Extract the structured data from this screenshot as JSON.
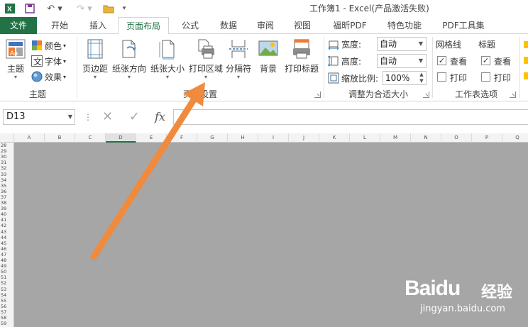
{
  "window": {
    "title": "工作簿1 - Excel(产品激活失败)"
  },
  "tabs": [
    {
      "label": "文件"
    },
    {
      "label": "开始"
    },
    {
      "label": "插入"
    },
    {
      "label": "页面布局"
    },
    {
      "label": "公式"
    },
    {
      "label": "数据"
    },
    {
      "label": "审阅"
    },
    {
      "label": "视图"
    },
    {
      "label": "福昕PDF"
    },
    {
      "label": "特色功能"
    },
    {
      "label": "PDF工具集"
    }
  ],
  "ribbon": {
    "theme_group": {
      "label": "主题",
      "theme_btn": "主题",
      "colors_btn": "颜色",
      "fonts_btn": "字体",
      "effects_btn": "效果"
    },
    "page_setup_group": {
      "label": "页面设置",
      "margins_btn": "页边距",
      "orientation_btn": "纸张方向",
      "size_btn": "纸张大小",
      "print_area_btn": "打印区域",
      "breaks_btn": "分隔符",
      "background_btn": "背景",
      "print_titles_btn": "打印标题"
    },
    "scale_group": {
      "label": "调整为合适大小",
      "width_label": "宽度:",
      "width_value": "自动",
      "height_label": "高度:",
      "height_value": "自动",
      "scale_label": "缩放比例:",
      "scale_value": "100%"
    },
    "sheet_options_group": {
      "label": "工作表选项",
      "gridlines_header": "网格线",
      "headings_header": "标题",
      "view_label": "查看",
      "print_label": "打印"
    }
  },
  "formula_bar": {
    "name_box": "D13",
    "fx": "fx"
  },
  "grid": {
    "columns": [
      "A",
      "B",
      "C",
      "D",
      "E",
      "F",
      "G",
      "H",
      "I",
      "J",
      "K",
      "L",
      "M",
      "N",
      "O",
      "P",
      "Q"
    ],
    "selected_column": "D",
    "rows": [
      "28",
      "29",
      "30",
      "31",
      "32",
      "33",
      "34",
      "35",
      "36",
      "37",
      "38",
      "39",
      "40",
      "41",
      "42",
      "43",
      "44",
      "45",
      "46",
      "47",
      "48",
      "49",
      "50",
      "51",
      "52",
      "53",
      "54",
      "55",
      "56",
      "57",
      "58",
      "59"
    ]
  },
  "watermark": {
    "brand": "Baidu",
    "cn": "经验",
    "url": "jingyan.baidu.com"
  },
  "colors": {
    "excel_green": "#217346",
    "arrow_orange": "#f08a3c",
    "sheet_gray": "#a6a6a6"
  }
}
